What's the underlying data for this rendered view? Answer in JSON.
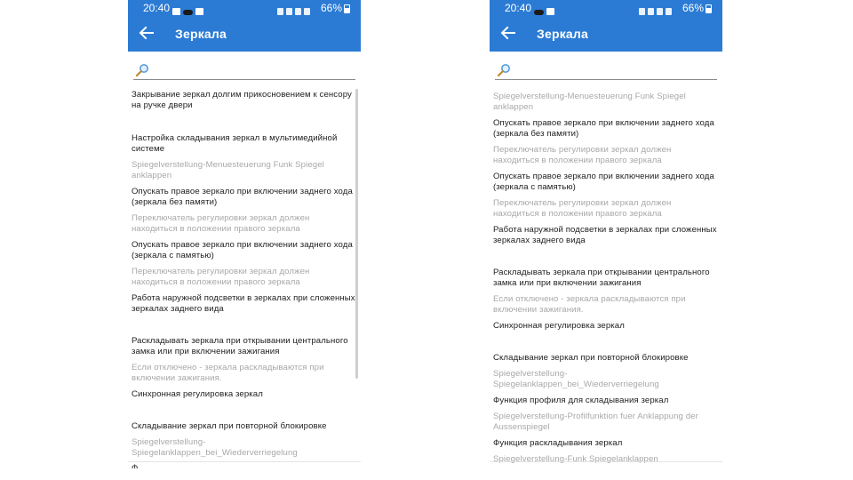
{
  "status_bar": {
    "time": "20:40",
    "battery": "66%"
  },
  "app_bar": {
    "title": "Зеркала",
    "back_icon": "arrow-back-icon"
  },
  "search": {
    "icon": "magnifier-icon",
    "value": ""
  },
  "colors": {
    "app_bar": "#2b7bd4",
    "primary_text": "#1e1e1e",
    "secondary_text": "#a8a8a8"
  },
  "left_screen": {
    "items": [
      {
        "type": "main",
        "text": "Закрывание зеркал долгим прикосновением к сенсору на ручке двери"
      },
      {
        "type": "main",
        "text": "Настройка складывания зеркал в мультимедийной системе"
      },
      {
        "type": "sub",
        "text": "Spiegelverstellung-Menuesteuerung Funk Spiegel anklappen"
      },
      {
        "type": "main",
        "text": "Опускать правое зеркало при включении заднего хода (зеркала без памяти)"
      },
      {
        "type": "sub",
        "text": "Переключатель регулировки зеркал должен находиться в положении правого зеркала"
      },
      {
        "type": "main",
        "text": "Опускать правое зеркало при включении заднего хода (зеркала с памятью)"
      },
      {
        "type": "sub",
        "text": "Переключатель регулировки зеркал должен находиться в положении правого зеркала"
      },
      {
        "type": "main",
        "text": "Работа наружной подсветки в зеркалах при сложенных зеркалах заднего вида"
      },
      {
        "type": "main",
        "text": "Раскладывать зеркала при открывании центрального замка или при включении зажигания"
      },
      {
        "type": "sub",
        "text": "Если отключено - зеркала раскладываются при включении зажигания."
      },
      {
        "type": "main",
        "text": "Синхронная регулировка зеркал"
      },
      {
        "type": "main",
        "text": "Складывание зеркал при повторной блокировке"
      },
      {
        "type": "sub",
        "text": "Spiegelverstellung-Spiegelanklappen_bei_Wiederverriegelung"
      }
    ]
  },
  "right_screen": {
    "items": [
      {
        "type": "sub",
        "text": "Spiegelverstellung-Menuesteuerung Funk Spiegel anklappen"
      },
      {
        "type": "main",
        "text": "Опускать правое зеркало при включении заднего хода (зеркала без памяти)"
      },
      {
        "type": "sub",
        "text": "Переключатель регулировки зеркал должен находиться в положении правого зеркала"
      },
      {
        "type": "main",
        "text": "Опускать правое зеркало при включении заднего хода (зеркала с памятью)"
      },
      {
        "type": "sub",
        "text": "Переключатель регулировки зеркал должен находиться в положении правого зеркала"
      },
      {
        "type": "main",
        "text": "Работа наружной подсветки в зеркалах при сложенных зеркалах заднего вида"
      },
      {
        "type": "main",
        "text": "Раскладывать зеркала при открывании центрального замка или при включении зажигания"
      },
      {
        "type": "sub",
        "text": "Если отключено - зеркала раскладываются при включении зажигания."
      },
      {
        "type": "main",
        "text": "Синхронная регулировка зеркал"
      },
      {
        "type": "main",
        "text": "Складывание зеркал при повторной блокировке"
      },
      {
        "type": "sub",
        "text": "Spiegelverstellung-Spiegelanklappen_bei_Wiederverriegelung"
      },
      {
        "type": "main",
        "text": "Функция профиля для складывания зеркал"
      },
      {
        "type": "sub",
        "text": "Spiegelverstellung-Profilfunktion fuer Anklappung der Aussenspiegel"
      },
      {
        "type": "main",
        "text": "Функция раскладывания зеркал"
      },
      {
        "type": "sub",
        "text": "Spiegelverstellung-Funk Spiegelanklappen"
      }
    ]
  }
}
